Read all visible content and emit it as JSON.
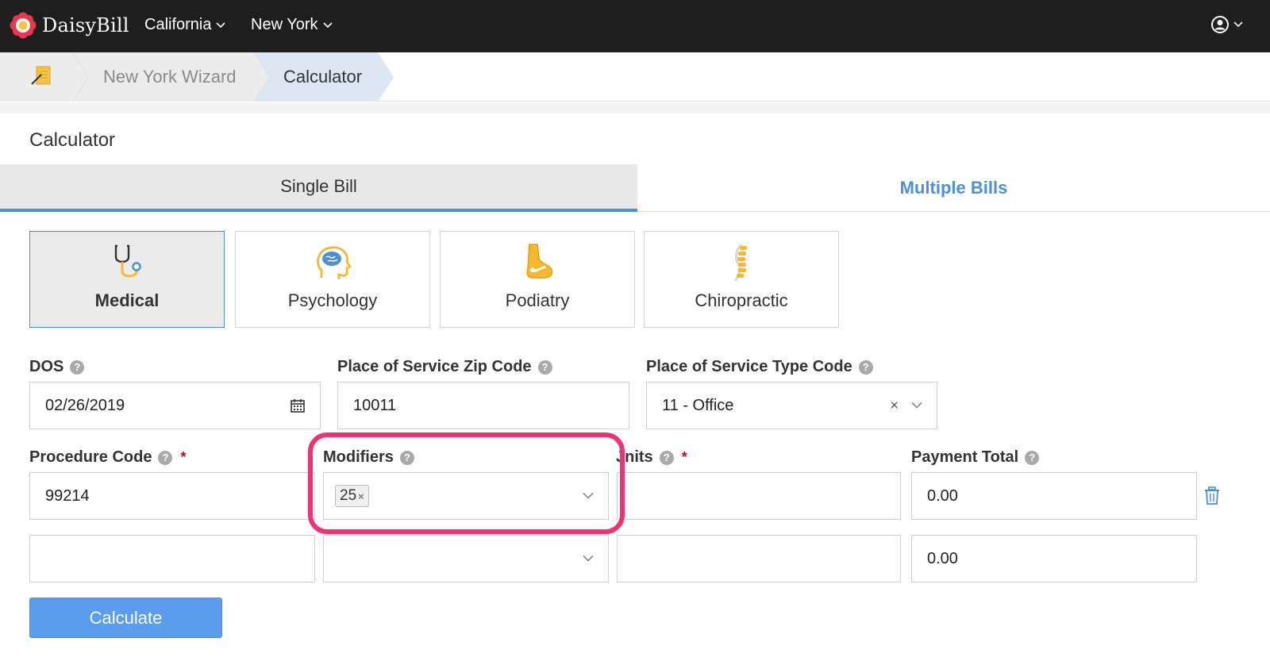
{
  "app": {
    "brand": "DaisyBill"
  },
  "nav": {
    "items": [
      {
        "label": "California"
      },
      {
        "label": "New York"
      }
    ]
  },
  "breadcrumb": {
    "items": [
      {
        "label": "New York Wizard"
      },
      {
        "label": "Calculator"
      }
    ]
  },
  "page": {
    "title": "Calculator"
  },
  "tabs": [
    {
      "label": "Single Bill",
      "active": true
    },
    {
      "label": "Multiple Bills",
      "active": false
    }
  ],
  "specialties": [
    {
      "label": "Medical",
      "icon": "stethoscope-icon",
      "active": true
    },
    {
      "label": "Psychology",
      "icon": "brain-icon",
      "active": false
    },
    {
      "label": "Podiatry",
      "icon": "foot-icon",
      "active": false
    },
    {
      "label": "Chiropractic",
      "icon": "spine-icon",
      "active": false
    }
  ],
  "form": {
    "dos": {
      "label": "DOS",
      "value": "02/26/2019"
    },
    "zip": {
      "label": "Place of Service Zip Code",
      "value": "10011"
    },
    "type_code": {
      "label": "Place of Service Type Code",
      "value": "11 - Office"
    },
    "procedure": {
      "label": "Procedure Code",
      "required_mark": "*"
    },
    "modifiers": {
      "label": "Modifiers"
    },
    "units": {
      "label": "Units",
      "visible_label": "Jnits",
      "required_mark": "*"
    },
    "payment": {
      "label": "Payment Total"
    },
    "rows": [
      {
        "procedure": "99214",
        "modifier_tag": "25",
        "units": "",
        "payment": "0.00"
      },
      {
        "procedure": "",
        "modifier_tag": "",
        "units": "",
        "payment": "0.00"
      }
    ],
    "calculate_label": "Calculate"
  },
  "colors": {
    "accent": "#4a90d9",
    "highlight": "#f0326e",
    "button": "#5b9ded",
    "navbar": "#1e1e1e"
  }
}
